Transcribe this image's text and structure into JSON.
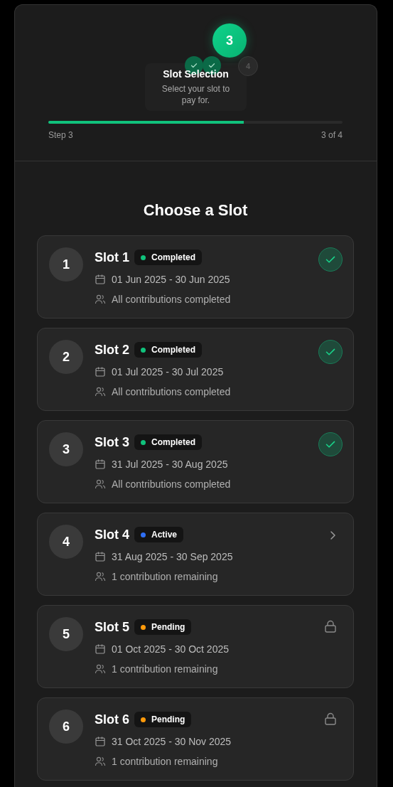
{
  "stepper": {
    "steps": [
      {
        "kind": "done"
      },
      {
        "kind": "done"
      },
      {
        "kind": "current",
        "label": "3"
      },
      {
        "kind": "upcoming",
        "label": "4"
      }
    ],
    "tooltip": {
      "title": "Slot Selection",
      "description": "Select your slot to pay for."
    },
    "progress": {
      "level": 0.665,
      "left_label": "Step 3",
      "right_label": "3 of 4"
    }
  },
  "heading": "Choose a Slot",
  "slots": [
    {
      "number": "1",
      "title": "Slot 1",
      "status": {
        "kind": "completed",
        "label": "Completed",
        "color": "#10c27c"
      },
      "dates": "01 Jun 2025 - 30 Jun 2025",
      "contributions": "All contributions completed"
    },
    {
      "number": "2",
      "title": "Slot 2",
      "status": {
        "kind": "completed",
        "label": "Completed",
        "color": "#10c27c"
      },
      "dates": "01 Jul 2025 - 30 Jul 2025",
      "contributions": "All contributions completed"
    },
    {
      "number": "3",
      "title": "Slot 3",
      "status": {
        "kind": "completed",
        "label": "Completed",
        "color": "#10c27c"
      },
      "dates": "31 Jul 2025 - 30 Aug 2025",
      "contributions": "All contributions completed"
    },
    {
      "number": "4",
      "title": "Slot 4",
      "status": {
        "kind": "active",
        "label": "Active",
        "color": "#2f6ff5"
      },
      "dates": "31 Aug 2025 - 30 Sep 2025",
      "contributions": "1 contribution remaining"
    },
    {
      "number": "5",
      "title": "Slot 5",
      "status": {
        "kind": "pending",
        "label": "Pending",
        "color": "#ff9a0a"
      },
      "dates": "01 Oct 2025 - 30 Oct 2025",
      "contributions": "1 contribution remaining"
    },
    {
      "number": "6",
      "title": "Slot 6",
      "status": {
        "kind": "pending",
        "label": "Pending",
        "color": "#ff9a0a"
      },
      "dates": "31 Oct 2025 - 30 Nov 2025",
      "contributions": "1 contribution remaining"
    }
  ]
}
